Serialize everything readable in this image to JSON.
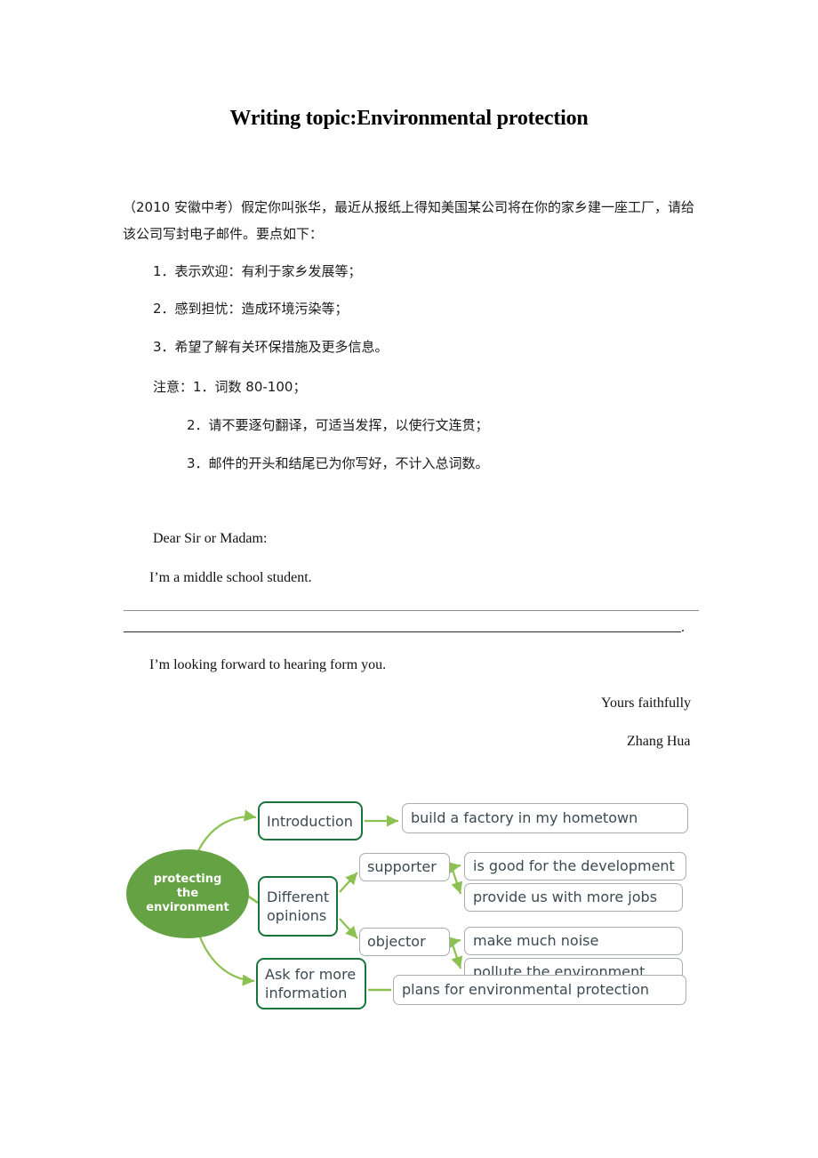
{
  "document": {
    "title": "Writing topic:Environmental protection",
    "intro": "（2010 安徽中考）假定你叫张华，最近从报纸上得知美国某公司将在你的家乡建一座工厂，请给该公司写封电子邮件。要点如下：",
    "points": [
      "1．表示欢迎：有利于家乡发展等；",
      "2．感到担忧：造成环境污染等；",
      "3．希望了解有关环保措施及更多信息。"
    ],
    "notes": {
      "head": "注意：1．词数 80-100；",
      "item2": "2．请不要逐句翻译，可适当发挥，以使行文连贯；",
      "item3": "3．邮件的开头和结尾已为你写好，不计入总词数。"
    },
    "letter": {
      "salutation": "Dear Sir or Madam:",
      "opening": "I’m a middle school student.",
      "blank_line_terminator": ".",
      "closing": "I’m looking forward to hearing form you.",
      "signoff": "Yours faithfully",
      "signature": "Zhang Hua"
    }
  },
  "mindmap": {
    "center": "protecting\nthe\nenvironment",
    "center_line1": "protecting",
    "center_line2": "the",
    "center_line3": "environment",
    "branches": {
      "introduction": "Introduction",
      "different_opinions_l1": "Different",
      "different_opinions_l2": "opinions",
      "ask_more_l1": "Ask for more",
      "ask_more_l2": "information"
    },
    "sub": {
      "supporter": "supporter",
      "objector": "objector"
    },
    "leaves": {
      "build": "build a factory in my hometown",
      "good": "is good for the development",
      "jobs": "provide us with more jobs",
      "noise": "make much noise",
      "pollute": "pollute the environment",
      "plans": "plans for environmental protection"
    }
  },
  "colors": {
    "center_fill": "#65a244",
    "primary_border": "#18753a",
    "secondary_border": "#a9adb0",
    "connector": "#8cc152",
    "node_text": "#3c4a52"
  }
}
